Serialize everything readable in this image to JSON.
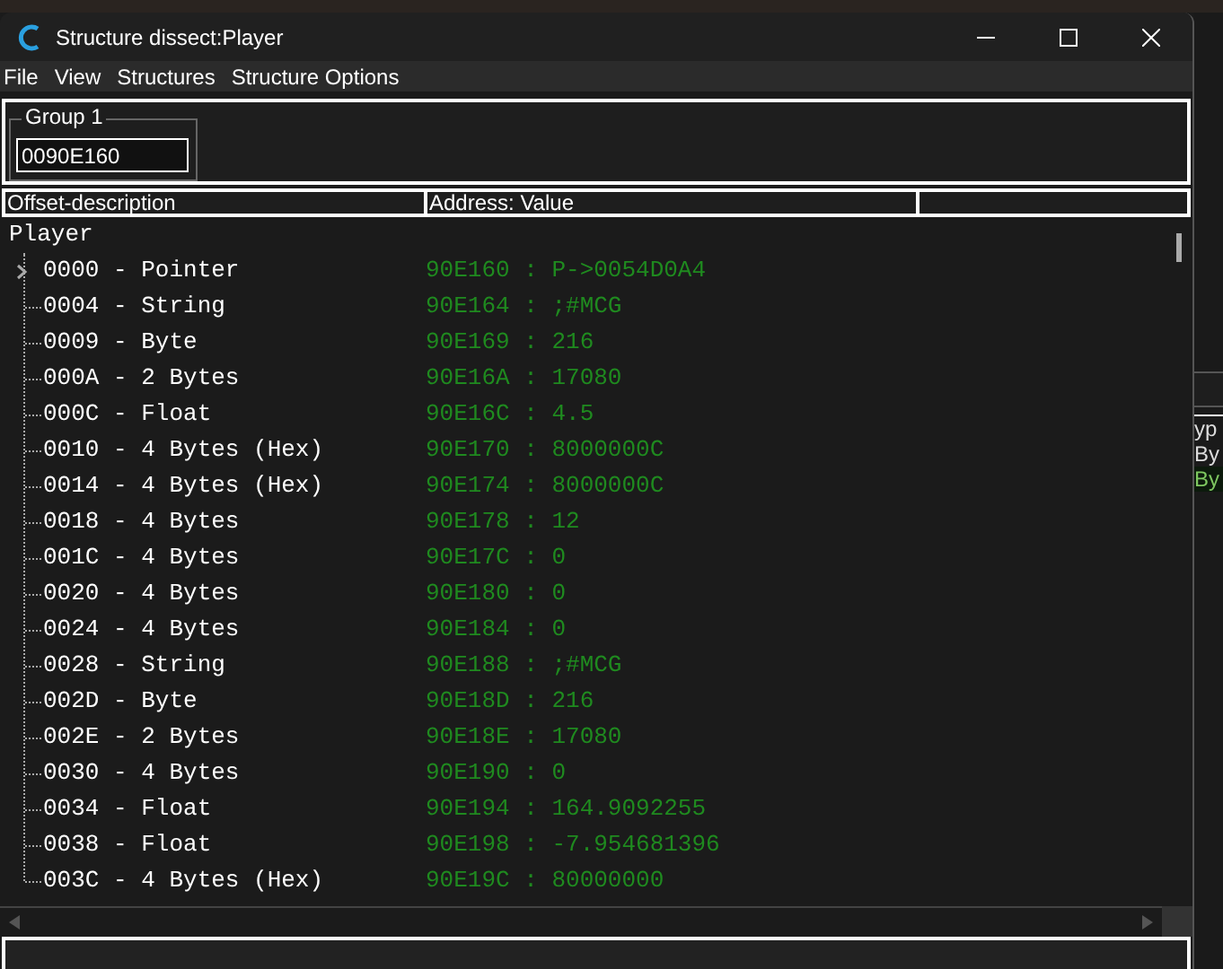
{
  "window": {
    "title": "Structure dissect:Player"
  },
  "menu": [
    "File",
    "View",
    "Structures",
    "Structure Options"
  ],
  "group": {
    "label": "Group 1",
    "value": "0090E160"
  },
  "columns": [
    "Offset-description",
    "Address: Value"
  ],
  "root": "Player",
  "rows": [
    {
      "offset": "0000 - Pointer",
      "value": "90E160 : P->0054D0A4",
      "expandable": true
    },
    {
      "offset": "0004 - String",
      "value": "90E164 : ;#MCG",
      "expandable": false
    },
    {
      "offset": "0009 - Byte",
      "value": "90E169 : 216",
      "expandable": false
    },
    {
      "offset": "000A - 2 Bytes",
      "value": "90E16A : 17080",
      "expandable": false
    },
    {
      "offset": "000C - Float",
      "value": "90E16C : 4.5",
      "expandable": false
    },
    {
      "offset": "0010 - 4 Bytes (Hex)",
      "value": "90E170 : 8000000C",
      "expandable": false
    },
    {
      "offset": "0014 - 4 Bytes (Hex)",
      "value": "90E174 : 8000000C",
      "expandable": false
    },
    {
      "offset": "0018 - 4 Bytes",
      "value": "90E178 : 12",
      "expandable": false
    },
    {
      "offset": "001C - 4 Bytes",
      "value": "90E17C : 0",
      "expandable": false
    },
    {
      "offset": "0020 - 4 Bytes",
      "value": "90E180 : 0",
      "expandable": false
    },
    {
      "offset": "0024 - 4 Bytes",
      "value": "90E184 : 0",
      "expandable": false
    },
    {
      "offset": "0028 - String",
      "value": "90E188 : ;#MCG",
      "expandable": false
    },
    {
      "offset": "002D - Byte",
      "value": "90E18D : 216",
      "expandable": false
    },
    {
      "offset": "002E - 2 Bytes",
      "value": "90E18E : 17080",
      "expandable": false
    },
    {
      "offset": "0030 - 4 Bytes",
      "value": "90E190 : 0",
      "expandable": false
    },
    {
      "offset": "0034 - Float",
      "value": "90E194 : 164.9092255",
      "expandable": false
    },
    {
      "offset": "0038 - Float",
      "value": "90E198 : -7.954681396",
      "expandable": false
    },
    {
      "offset": "003C - 4 Bytes (Hex)",
      "value": "90E19C : 80000000",
      "expandable": false
    }
  ],
  "background_panel": {
    "header": "yp",
    "rows": [
      {
        "text": "By",
        "highlighted": false
      },
      {
        "text": "By",
        "highlighted": true
      }
    ]
  }
}
